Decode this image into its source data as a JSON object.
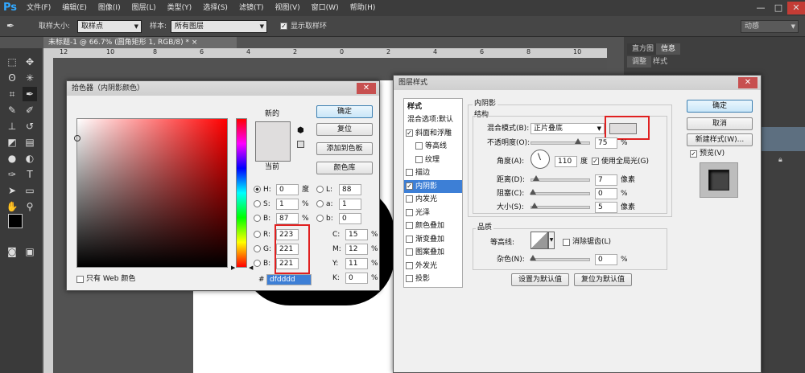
{
  "app": {
    "logo": "Ps"
  },
  "menu": [
    "文件(F)",
    "编辑(E)",
    "图像(I)",
    "图层(L)",
    "类型(Y)",
    "选择(S)",
    "滤镜(T)",
    "视图(V)",
    "窗口(W)",
    "帮助(H)"
  ],
  "window_buttons": {
    "minimize": "—",
    "maximize": "□",
    "close": "✕"
  },
  "options_bar": {
    "sample_size_label": "取样大小:",
    "sample_size_value": "取样点",
    "sample_label": "样本:",
    "sample_value": "所有图层",
    "show_ring_label": "显示取样环",
    "show_ring_checked": true,
    "workspace": "动感"
  },
  "document_tab": {
    "title": "未标题-1 @ 66.7% (圆角矩形 1, RGB/8) *",
    "close": "×"
  },
  "ruler_ticks": [
    "12",
    "10",
    "8",
    "6",
    "4",
    "2",
    "0",
    "2",
    "4",
    "6",
    "8",
    "10"
  ],
  "right_panel": {
    "tabs": [
      "直方图",
      "信息"
    ],
    "sub_tabs": [
      "调整",
      "样式"
    ]
  },
  "color_picker": {
    "title": "拾色器（内阴影颜色）",
    "new_label": "新的",
    "current_label": "当前",
    "ok": "确定",
    "reset": "复位",
    "add_swatch": "添加到色板",
    "color_libraries": "颜色库",
    "only_web": "只有 Web 颜色",
    "hsb": [
      {
        "k": "H:",
        "v": "0",
        "u": "度",
        "on": true
      },
      {
        "k": "S:",
        "v": "1",
        "u": "%",
        "on": false
      },
      {
        "k": "B:",
        "v": "87",
        "u": "%",
        "on": false
      }
    ],
    "lab": [
      {
        "k": "L:",
        "v": "88"
      },
      {
        "k": "a:",
        "v": "1"
      },
      {
        "k": "b:",
        "v": "0"
      }
    ],
    "rgb": [
      {
        "k": "R:",
        "v": "223"
      },
      {
        "k": "G:",
        "v": "221"
      },
      {
        "k": "B:",
        "v": "221"
      }
    ],
    "cmyk": [
      {
        "k": "C:",
        "v": "15",
        "u": "%"
      },
      {
        "k": "M:",
        "v": "12",
        "u": "%"
      },
      {
        "k": "Y:",
        "v": "11",
        "u": "%"
      },
      {
        "k": "K:",
        "v": "0",
        "u": "%"
      }
    ],
    "hex_label": "#",
    "hex": "dfdddd",
    "new_color": "#dfdddd",
    "current_color": "#dfdddd"
  },
  "layer_style": {
    "title": "图层样式",
    "sidebar_header": "样式",
    "sidebar": [
      {
        "label": "混合选项:默认",
        "cb": null,
        "selected": false
      },
      {
        "label": "斜面和浮雕",
        "cb": true,
        "selected": false
      },
      {
        "label": "等高线",
        "cb": false,
        "selected": false,
        "indent": true
      },
      {
        "label": "纹理",
        "cb": false,
        "selected": false,
        "indent": true
      },
      {
        "label": "描边",
        "cb": false,
        "selected": false
      },
      {
        "label": "内阴影",
        "cb": true,
        "selected": true
      },
      {
        "label": "内发光",
        "cb": false,
        "selected": false
      },
      {
        "label": "光泽",
        "cb": false,
        "selected": false
      },
      {
        "label": "颜色叠加",
        "cb": false,
        "selected": false
      },
      {
        "label": "渐变叠加",
        "cb": false,
        "selected": false
      },
      {
        "label": "图案叠加",
        "cb": false,
        "selected": false
      },
      {
        "label": "外发光",
        "cb": false,
        "selected": false
      },
      {
        "label": "投影",
        "cb": false,
        "selected": false
      }
    ],
    "section_title": "内阴影",
    "structure_title": "结构",
    "blend_mode_label": "混合模式(B):",
    "blend_mode": "正片叠底",
    "opacity_label": "不透明度(O):",
    "opacity": "75",
    "angle_label": "角度(A):",
    "angle": "110",
    "angle_unit": "度",
    "global_light": "使用全局光(G)",
    "distance_label": "距离(D):",
    "distance": "7",
    "choke_label": "阻塞(C):",
    "choke": "0",
    "size_label": "大小(S):",
    "size": "5",
    "px": "像素",
    "pct": "%",
    "quality_title": "品质",
    "contour_label": "等高线:",
    "anti_alias": "消除锯齿(L)",
    "noise_label": "杂色(N):",
    "noise": "0",
    "set_default": "设置为默认值",
    "reset_default": "复位为默认值",
    "ok": "确定",
    "cancel": "取消",
    "new_style": "新建样式(W)...",
    "preview": "预览(V)",
    "shadow_color": "#dfdddd"
  }
}
